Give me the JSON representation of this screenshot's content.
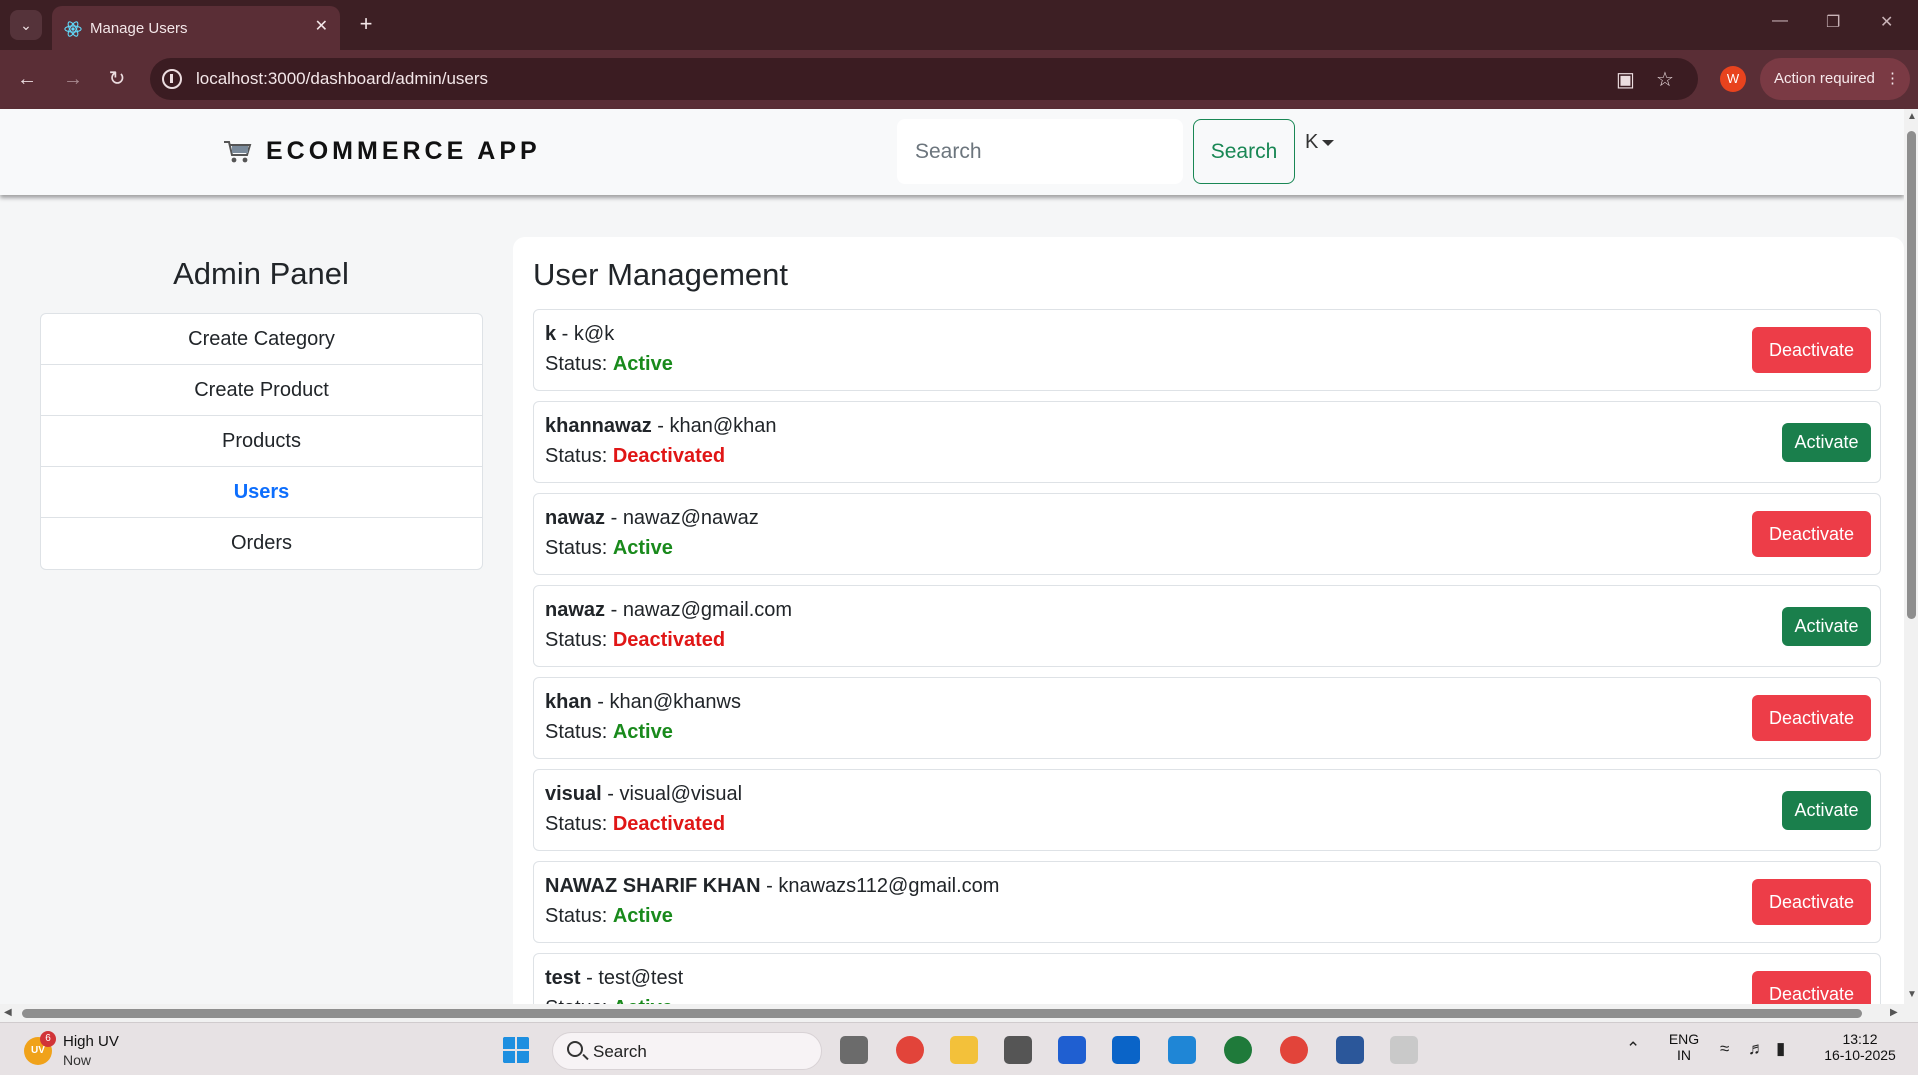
{
  "browser": {
    "tab_title": "Manage Users",
    "url": "localhost:3000/dashboard/admin/users",
    "profile_initial": "W",
    "action_required": "Action required"
  },
  "header": {
    "brand": "ECOMMERCE APP",
    "search_placeholder": "Search",
    "search_button": "Search",
    "user_initial": "K"
  },
  "sidebar": {
    "title": "Admin Panel",
    "items": [
      {
        "label": "Create Category",
        "active": false
      },
      {
        "label": "Create Product",
        "active": false
      },
      {
        "label": "Products",
        "active": false
      },
      {
        "label": "Users",
        "active": true
      },
      {
        "label": "Orders",
        "active": false
      }
    ]
  },
  "main": {
    "title": "User Management",
    "status_label": "Status:",
    "users": [
      {
        "name": "k",
        "email": "k@k",
        "status": "Active",
        "action": "Deactivate"
      },
      {
        "name": "khannawaz",
        "email": "khan@khan",
        "status": "Deactivated",
        "action": "Activate"
      },
      {
        "name": "nawaz",
        "email": "nawaz@nawaz",
        "status": "Active",
        "action": "Deactivate"
      },
      {
        "name": "nawaz",
        "email": "nawaz@gmail.com",
        "status": "Deactivated",
        "action": "Activate"
      },
      {
        "name": "khan",
        "email": "khan@khanws",
        "status": "Active",
        "action": "Deactivate"
      },
      {
        "name": "visual",
        "email": "visual@visual",
        "status": "Deactivated",
        "action": "Activate"
      },
      {
        "name": "NAWAZ SHARIF KHAN",
        "email": "knawazs112@gmail.com",
        "status": "Active",
        "action": "Deactivate"
      },
      {
        "name": "test",
        "email": "test@test",
        "status": "Active",
        "action": "Deactivate"
      }
    ]
  },
  "taskbar": {
    "weather_title": "High UV",
    "weather_sub": "Now",
    "weather_badge": "6",
    "weather_icon_text": "UV",
    "search_label": "Search",
    "lang_line1": "ENG",
    "lang_line2": "IN",
    "time": "13:12",
    "date": "16-10-2025"
  },
  "colors": {
    "active_status": "#198a1c",
    "deactivated_status": "#e01616",
    "deactivate_button": "#ed3d48",
    "activate_button": "#1a7f4c",
    "active_nav": "#0d6efd",
    "search_border": "#198754"
  }
}
